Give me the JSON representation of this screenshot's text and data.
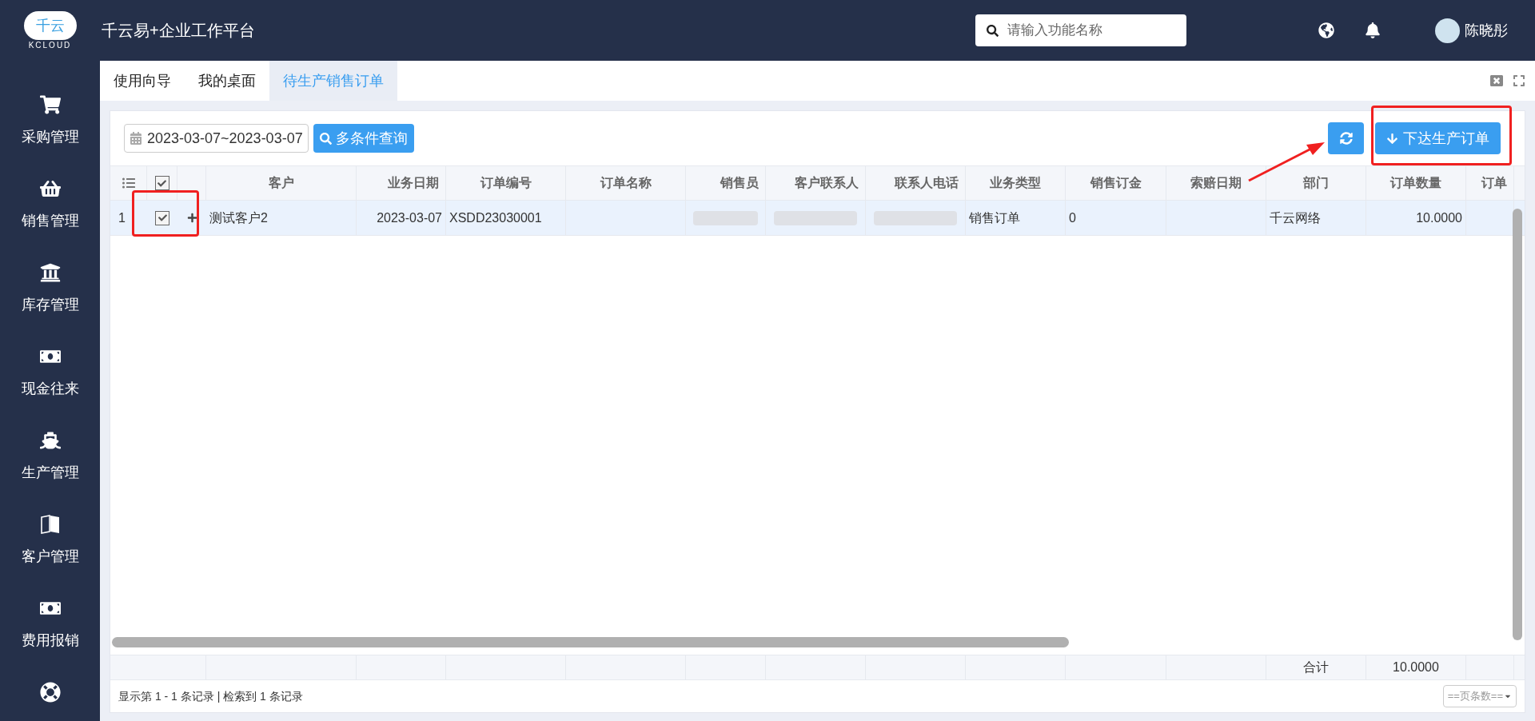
{
  "header": {
    "logo": {
      "text": "千云",
      "subtext": "KCLOUD"
    },
    "title": "千云易+企业工作平台",
    "search": {
      "placeholder": "请输入功能名称"
    },
    "user": {
      "name": "陈晓彤"
    }
  },
  "sidebar": {
    "items": [
      {
        "kind": "cart",
        "label": "采购管理"
      },
      {
        "kind": "basket",
        "label": "销售管理"
      },
      {
        "kind": "bank",
        "label": "库存管理"
      },
      {
        "kind": "money",
        "label": "现金往来"
      },
      {
        "kind": "ship",
        "label": "生产管理"
      },
      {
        "kind": "language",
        "label": "客户管理"
      },
      {
        "kind": "money",
        "label": "费用报销"
      },
      {
        "kind": "lifering"
      }
    ]
  },
  "tabs": [
    {
      "label": "使用向导",
      "selected": false
    },
    {
      "label": "我的桌面",
      "selected": false
    },
    {
      "label": "待生产销售订单",
      "selected": true
    }
  ],
  "toolbar": {
    "date_range": "2023-03-07~2023-03-07",
    "query_button": "多条件查询",
    "issue_button": "下达生产订单"
  },
  "table": {
    "header_checked": true,
    "columns": [
      "客户",
      "业务日期",
      "订单编号",
      "订单名称",
      "销售员",
      "客户联系人",
      "联系人电话",
      "业务类型",
      "销售订金",
      "索赔日期",
      "部门",
      "订单数量",
      "订单"
    ],
    "rows": [
      {
        "index": "1",
        "checked": true,
        "selected": true,
        "cells": [
          {
            "kind": "text",
            "text": "测试客户2"
          },
          {
            "kind": "text",
            "text": "2023-03-07"
          },
          {
            "kind": "text",
            "text": "XSDD23030001"
          },
          {
            "kind": "empty"
          },
          {
            "kind": "blurred"
          },
          {
            "kind": "blurred"
          },
          {
            "kind": "blurred"
          },
          {
            "kind": "text",
            "text": "销售订单"
          },
          {
            "kind": "text",
            "text": "0"
          },
          {
            "kind": "empty"
          },
          {
            "kind": "text",
            "text": "千云网络"
          },
          {
            "kind": "text",
            "text": "10.0000"
          },
          {
            "kind": "empty"
          }
        ]
      }
    ],
    "totals": {
      "label": "合计",
      "quantity": "10.0000"
    }
  },
  "footer": {
    "summary": "显示第 1 - 1 条记录 | 检索到 1 条记录",
    "page_size": "==页条数=="
  }
}
